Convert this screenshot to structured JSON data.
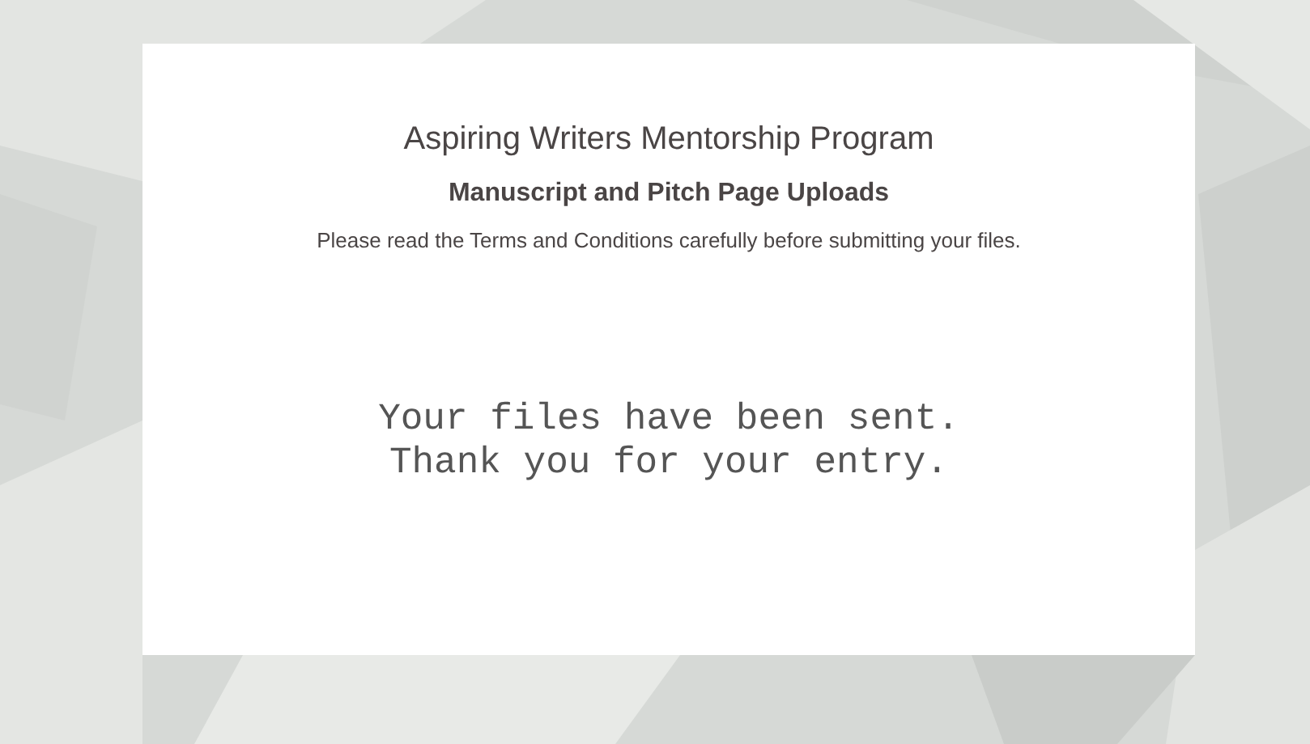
{
  "card": {
    "title": "Aspiring Writers Mentorship Program",
    "subtitle": "Manuscript and Pitch Page Uploads",
    "notice": "Please read the Terms and Conditions carefully before submitting your files.",
    "message_lines": [
      "Your files have been sent.",
      "Thank you for your entry."
    ]
  }
}
